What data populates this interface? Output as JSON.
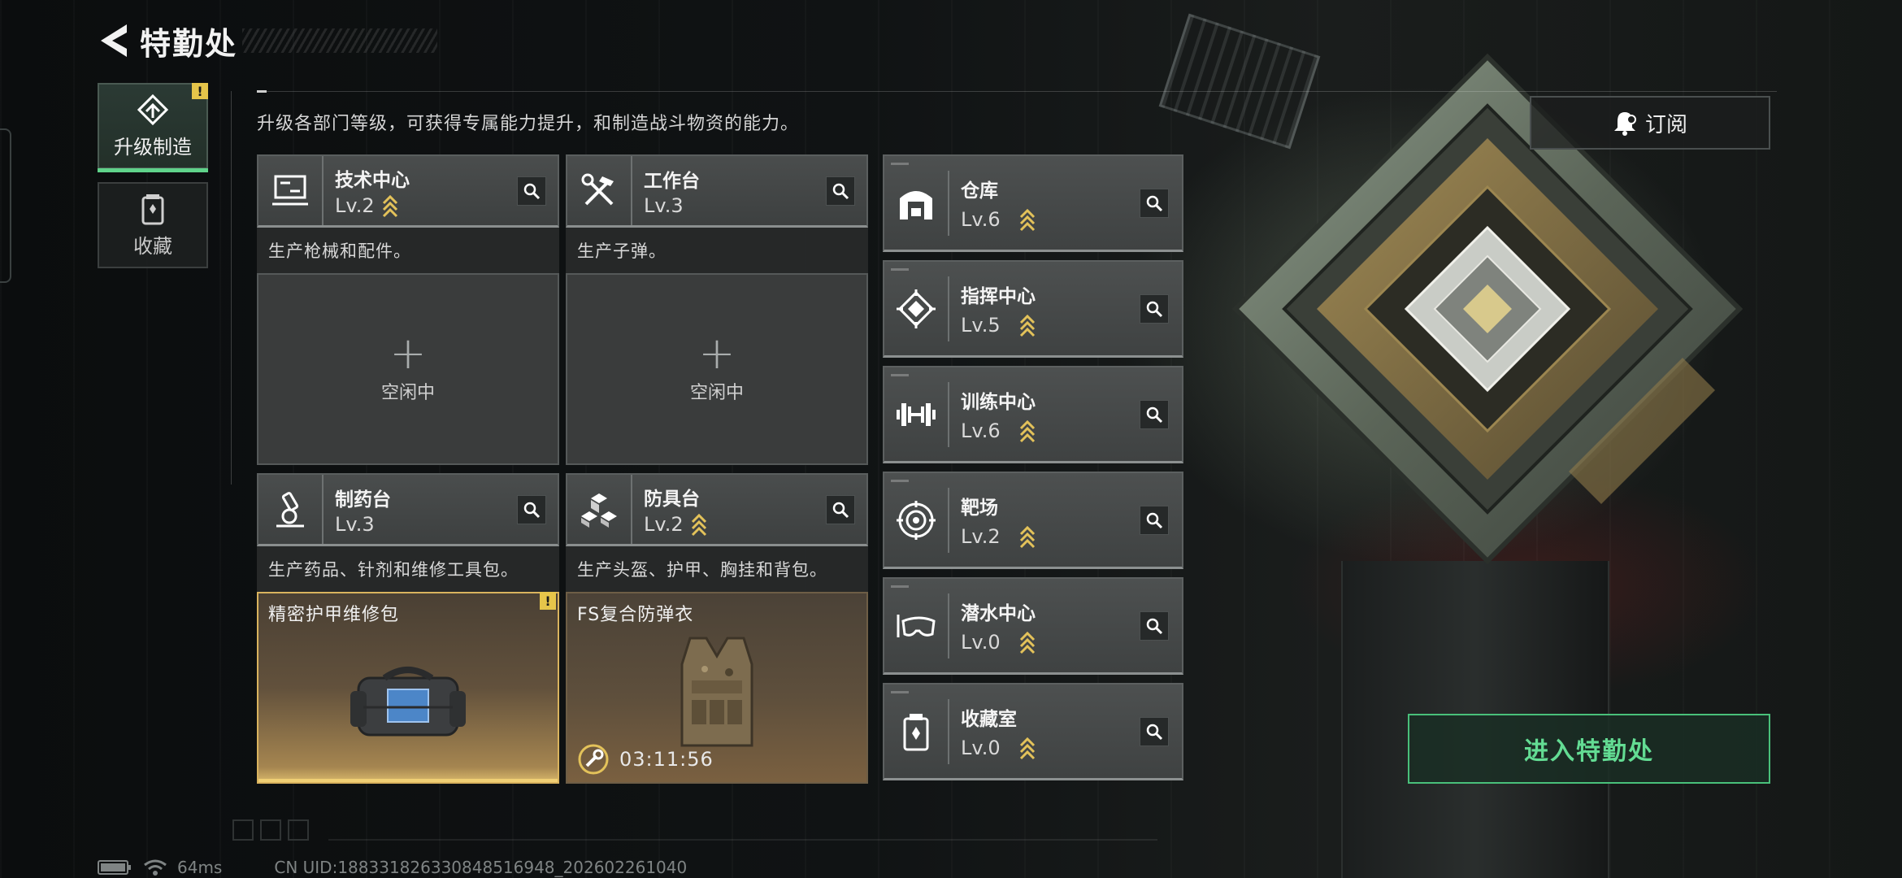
{
  "header": {
    "title": "特勤处"
  },
  "sidebar": {
    "tabs": [
      {
        "label": "升级制造",
        "active": true,
        "warning": "!"
      },
      {
        "label": "收藏",
        "active": false
      }
    ]
  },
  "description": "升级各部门等级，可获得专属能力提升，和制造战斗物资的能力。",
  "workshops": [
    {
      "name": "技术中心",
      "level": "Lv.2",
      "subtitle": "生产枪械和配件。",
      "status": "idle",
      "idle_label": "空闲中",
      "plus": "+"
    },
    {
      "name": "工作台",
      "level": "Lv.3",
      "subtitle": "生产子弹。",
      "status": "idle",
      "idle_label": "空闲中",
      "plus": "+"
    },
    {
      "name": "制药台",
      "level": "Lv.3",
      "subtitle": "生产药品、针剂和维修工具包。",
      "status": "ready",
      "product": "精密护甲维修包",
      "warning": "!"
    },
    {
      "name": "防具台",
      "level": "Lv.2",
      "subtitle": "生产头盔、护甲、胸挂和背包。",
      "status": "producing",
      "product": "FS复合防弹衣",
      "timer": "03:11:56"
    }
  ],
  "facilities": [
    {
      "name": "仓库",
      "level": "Lv.6"
    },
    {
      "name": "指挥中心",
      "level": "Lv.5"
    },
    {
      "name": "训练中心",
      "level": "Lv.6"
    },
    {
      "name": "靶场",
      "level": "Lv.2"
    },
    {
      "name": "潜水中心",
      "level": "Lv.0"
    },
    {
      "name": "收藏室",
      "level": "Lv.0"
    }
  ],
  "subscribe_label": "订阅",
  "enter_label": "进入特勤处",
  "status_bar": {
    "ping": "64ms",
    "uid": "CN UID:188331826330848516948_202602261040"
  },
  "colors": {
    "accent_green": "#49c07a",
    "upgrade_chevron": "#e3c25a",
    "warning": "#e6c54a",
    "ready_gold": "#d9b35e"
  }
}
